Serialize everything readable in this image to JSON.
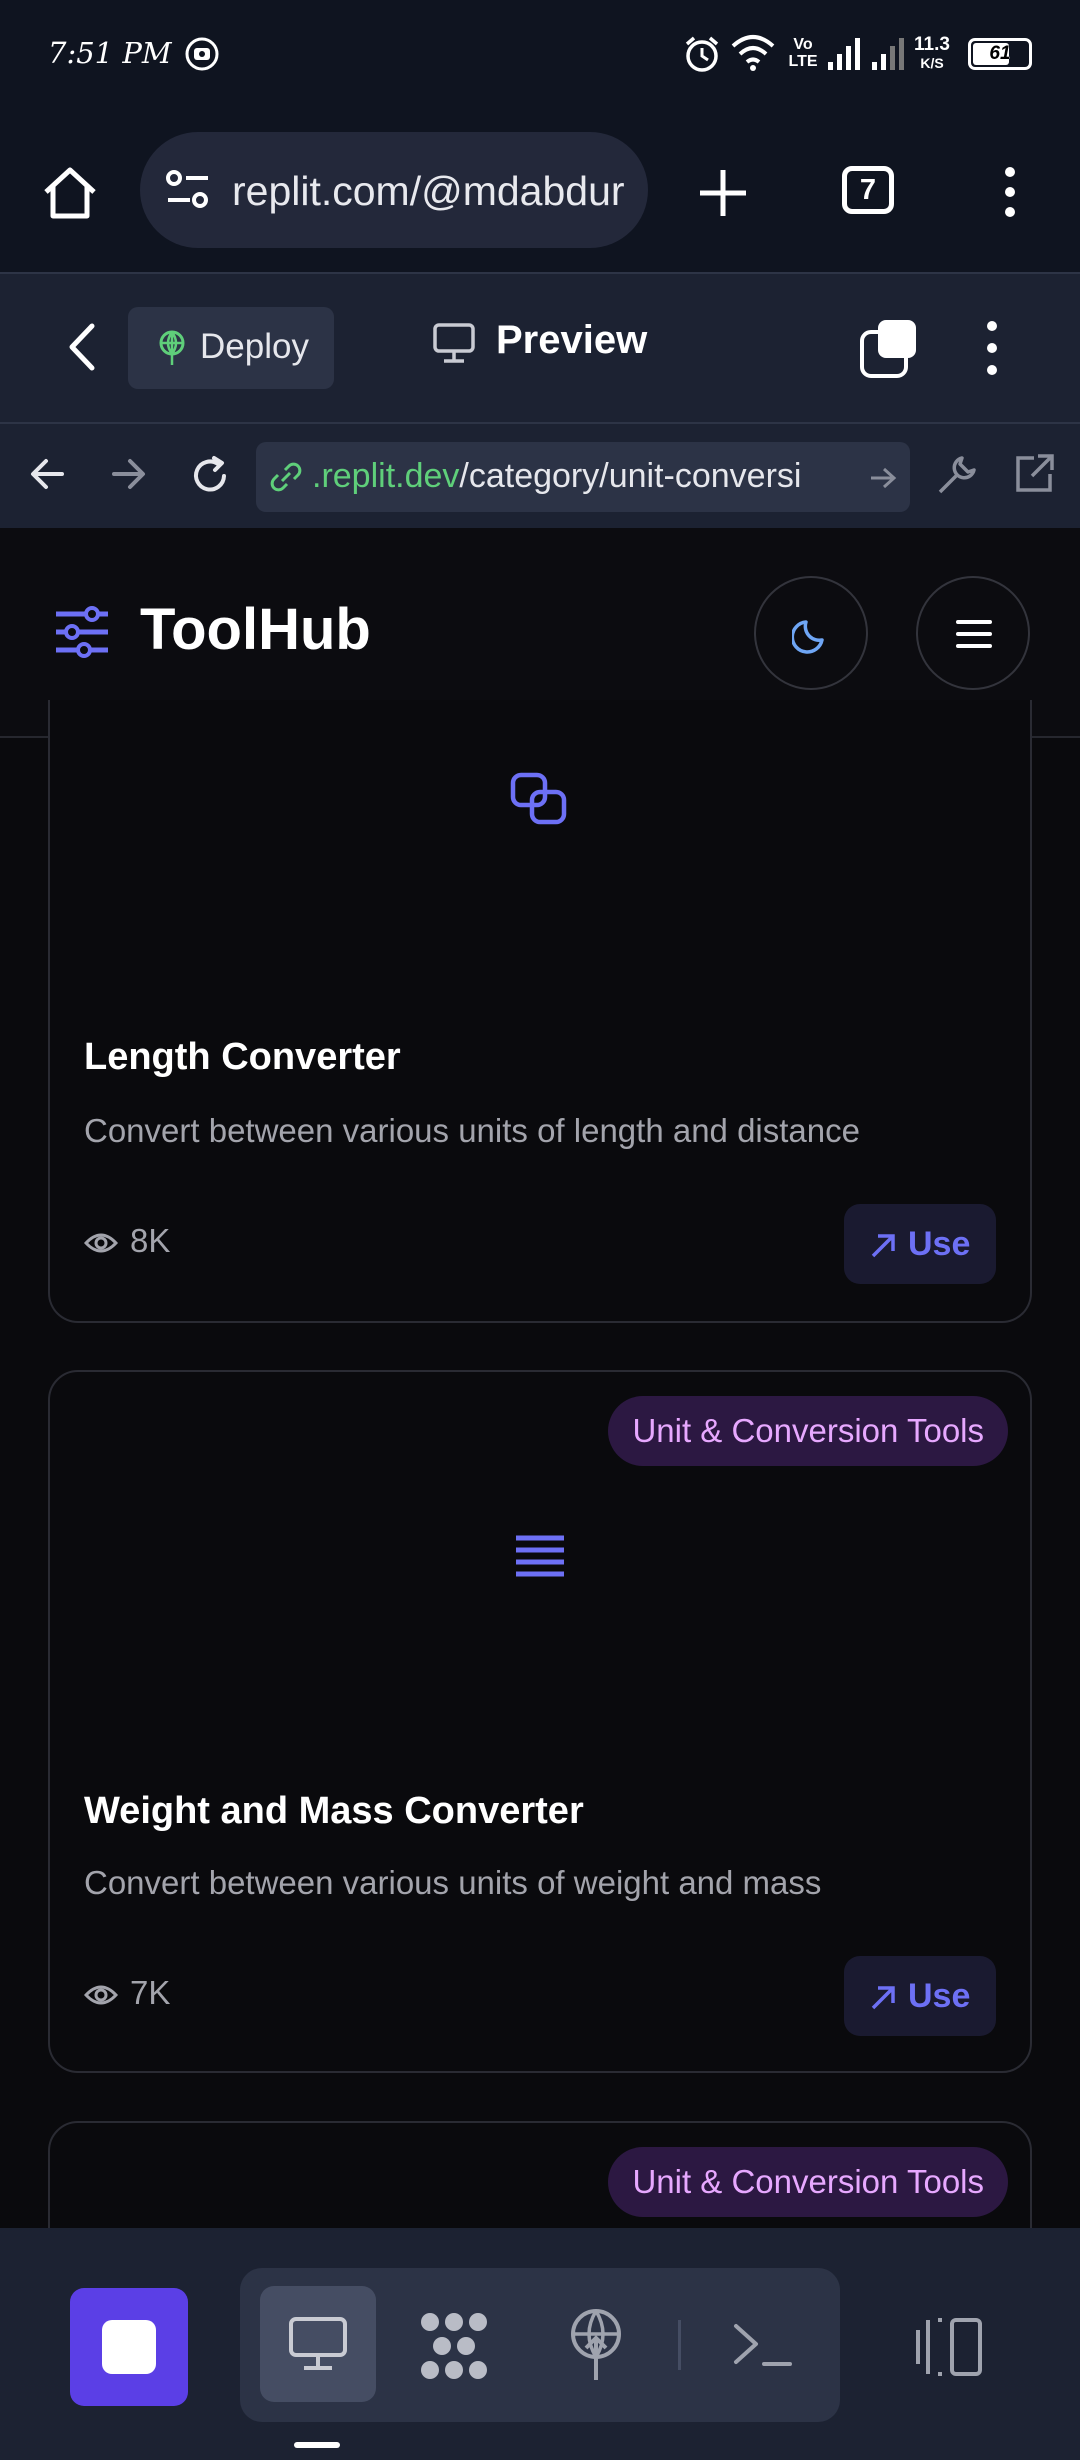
{
  "status_bar": {
    "time": "7:51 PM",
    "volte": "Vo LTE",
    "speed_value": "11.3",
    "speed_unit": "K/S",
    "battery": "61"
  },
  "browser": {
    "url": "replit.com/@mdabdur",
    "tab_count": "7"
  },
  "replit": {
    "deploy_label": "Deploy",
    "preview_label": "Preview",
    "inner_url_domain": ".replit.dev",
    "inner_url_path": "/category/unit-conversi"
  },
  "app": {
    "brand": "ToolHub"
  },
  "cards": [
    {
      "title": "Length Converter",
      "description": "Convert between various units of length and distance",
      "views": "8K",
      "use_label": "Use"
    },
    {
      "badge": "Unit & Conversion Tools",
      "title": "Weight and Mass Converter",
      "description": "Convert between various units of weight and mass",
      "views": "7K",
      "use_label": "Use"
    },
    {
      "badge": "Unit & Conversion Tools"
    }
  ],
  "colors": {
    "accent": "#6d70f5",
    "badge_bg": "#2c1842",
    "badge_text": "#e7a8ff",
    "stop_button": "#5b3fe6"
  }
}
